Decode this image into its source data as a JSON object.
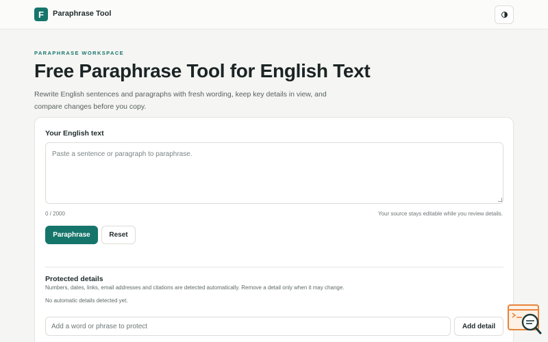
{
  "header": {
    "logo_letter": "F",
    "brand": "Paraphrase Tool",
    "theme_toggle_icon": "contrast-icon"
  },
  "hero": {
    "eyebrow": "PARAPHRASE WORKSPACE",
    "title": "Free Paraphrase Tool for English Text",
    "subtitle": "Rewrite English sentences and paragraphs with fresh wording, keep key details in view, and compare changes before you copy."
  },
  "editor": {
    "label": "Your English text",
    "placeholder": "Paste a sentence or paragraph to paraphrase.",
    "value": "",
    "counter": "0 / 2000",
    "hint": "Your source stays editable while you review details.",
    "paraphrase_label": "Paraphrase",
    "reset_label": "Reset"
  },
  "protected": {
    "title": "Protected details",
    "description": "Numbers, dates, links, email addresses and citations are detected automatically. Remove a detail only when it may change.",
    "empty_note": "No automatic details detected yet.",
    "input_placeholder": "Add a word or phrase to protect",
    "add_label": "Add detail"
  },
  "floating_widget": {
    "icon": "search-document-icon"
  },
  "colors": {
    "accent": "#16756b",
    "background": "#f5f5f3",
    "widget_orange": "#e8833a"
  }
}
